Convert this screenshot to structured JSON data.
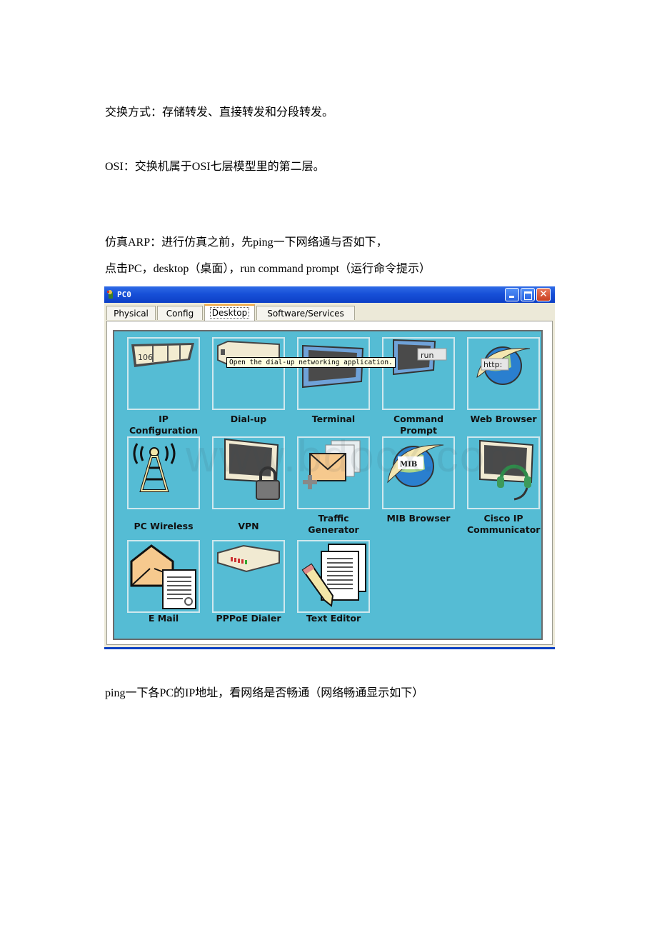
{
  "document": {
    "paragraphs": [
      "交换方式：存储转发、直接转发和分段转发。",
      "OSI：交换机属于OSI七层模型里的第二层。",
      "仿真ARP：进行仿真之前，先ping一下网络通与否如下，",
      "点击PC，desktop（桌面），run command prompt（运行命令提示）",
      "ping一下各PC的IP地址，看网络是否畅通（网络畅通显示如下）"
    ]
  },
  "window": {
    "title": "PC0",
    "controls": {
      "minimize": "minimize",
      "maximize": "maximize",
      "close": "✕"
    },
    "tabs": [
      {
        "label": "Physical",
        "active": false
      },
      {
        "label": "Config",
        "active": false
      },
      {
        "label": "Desktop",
        "active": true
      },
      {
        "label": "Software/Services",
        "active": false
      }
    ],
    "tooltip": "Open the dial-up networking application.",
    "watermark": "www.bdocx.com",
    "apps": [
      {
        "label": "IP Configuration",
        "icon": "ip-config-icon",
        "icon_text": "106"
      },
      {
        "label": "Dial-up",
        "icon": "modem-icon"
      },
      {
        "label": "Terminal",
        "icon": "terminal-icon"
      },
      {
        "label": "Command Prompt",
        "icon": "command-prompt-icon",
        "icon_text": "run"
      },
      {
        "label": "Web Browser",
        "icon": "web-browser-icon",
        "icon_text": "http:"
      },
      {
        "label": "PC Wireless",
        "icon": "wireless-tower-icon"
      },
      {
        "label": "VPN",
        "icon": "vpn-lock-icon"
      },
      {
        "label": "Traffic Generator",
        "icon": "traffic-generator-icon"
      },
      {
        "label": "MIB Browser",
        "icon": "mib-browser-icon",
        "icon_text": "MIB"
      },
      {
        "label": "Cisco IP Communicator",
        "icon": "headset-monitor-icon"
      },
      {
        "label": "E Mail",
        "icon": "email-icon"
      },
      {
        "label": "PPPoE Dialer",
        "icon": "pppoe-dialer-icon"
      },
      {
        "label": "Text Editor",
        "icon": "text-editor-icon"
      }
    ]
  }
}
